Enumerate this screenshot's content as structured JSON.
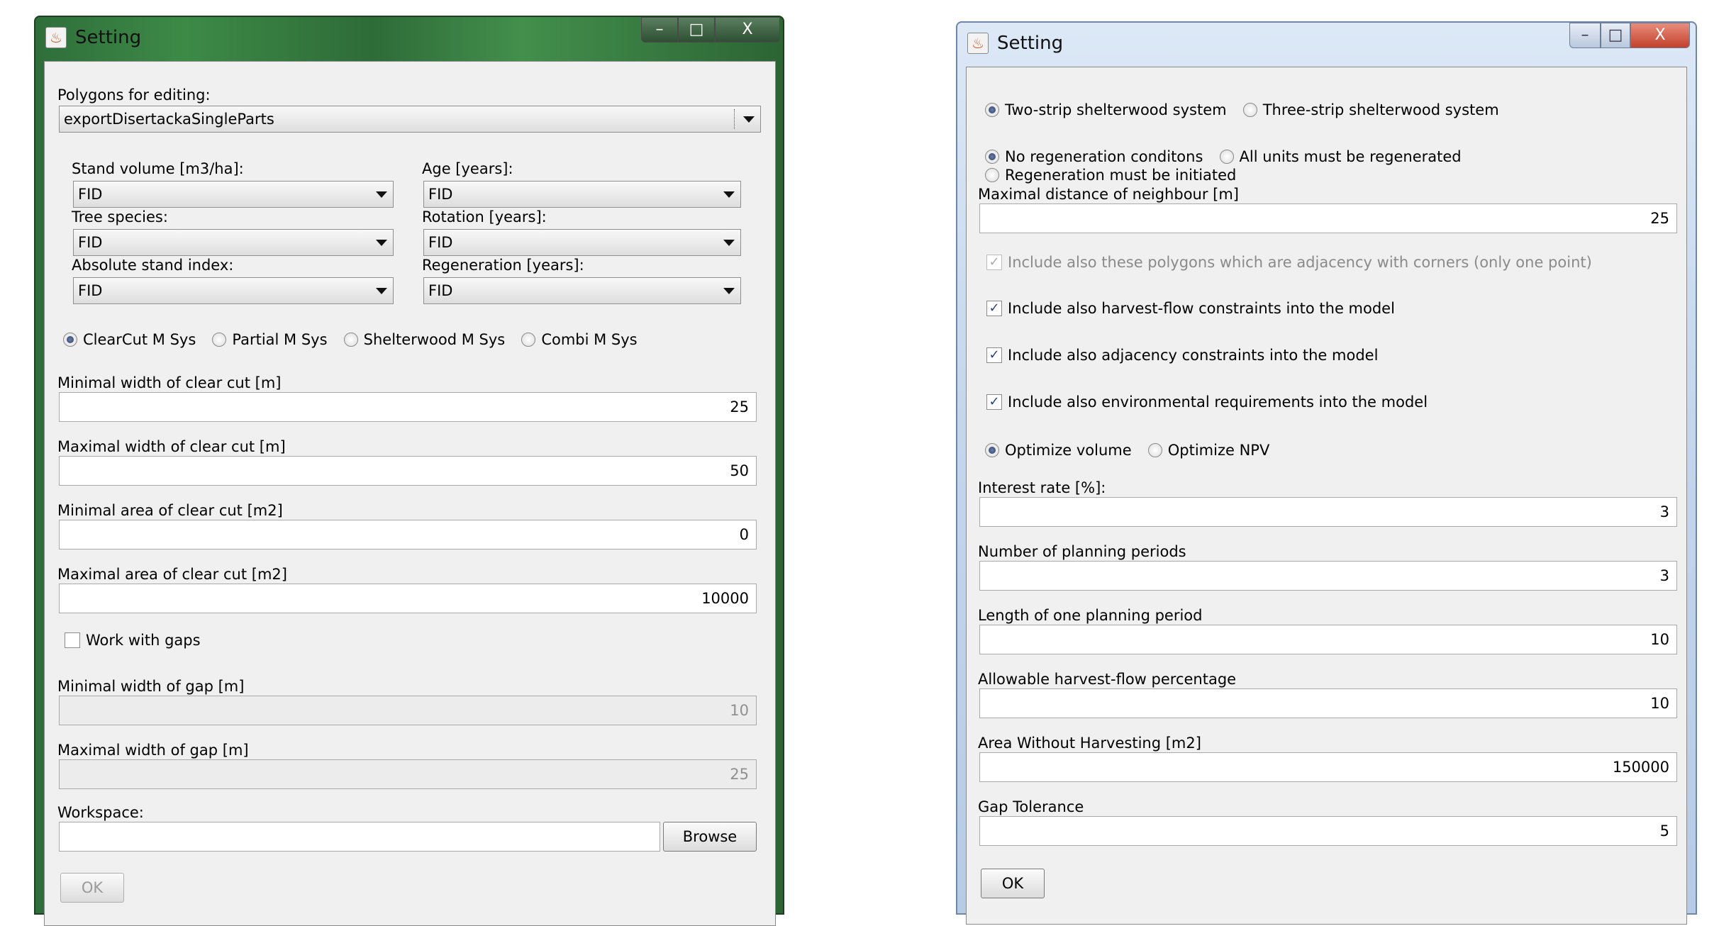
{
  "left_window": {
    "title": "Setting",
    "polygons_label": "Polygons for editing:",
    "polygons_value": "exportDisertackaSingleParts",
    "stand_volume_label": "Stand volume [m3/ha]:",
    "stand_volume_value": "FID",
    "age_label": "Age [years]:",
    "age_value": "FID",
    "tree_species_label": "Tree species:",
    "tree_species_value": "FID",
    "rotation_label": "Rotation [years]:",
    "rotation_value": "FID",
    "abs_index_label": "Absolute stand index:",
    "abs_index_value": "FID",
    "regeneration_label": "Regeneration [years]:",
    "regeneration_value": "FID",
    "systems": [
      "ClearCut M Sys",
      "Partial M Sys",
      "Shelterwood M Sys",
      "Combi M Sys"
    ],
    "min_width_label": "Minimal width of clear cut [m]",
    "min_width_value": "25",
    "max_width_label": "Maximal width of clear cut [m]",
    "max_width_value": "50",
    "min_area_label": "Minimal area of clear cut [m2]",
    "min_area_value": "0",
    "max_area_label": "Maximal area of clear cut [m2]",
    "max_area_value": "10000",
    "gaps_label": "Work with gaps",
    "min_gap_label": "Minimal width of gap [m]",
    "min_gap_value": "10",
    "max_gap_label": "Maximal width of gap [m]",
    "max_gap_value": "25",
    "workspace_label": "Workspace:",
    "workspace_value": "",
    "browse_label": "Browse",
    "ok_label": "OK"
  },
  "right_window": {
    "title": "Setting",
    "strip_options": [
      "Two-strip shelterwood system",
      "Three-strip shelterwood system"
    ],
    "regen_options": [
      "No regeneration conditons",
      "All units must be regenerated",
      "Regeneration must be initiated"
    ],
    "neighbour_label": "Maximal distance of neighbour [m]",
    "neighbour_value": "25",
    "cb_corners": "Include also these polygons which are adjacency with corners (only one point)",
    "cb_harvest": "Include also harvest-flow constraints into the model",
    "cb_adjacency": "Include also adjacency constraints into the model",
    "cb_environment": "Include also environmental requirements into the model",
    "optimize_options": [
      "Optimize volume",
      "Optimize NPV"
    ],
    "interest_label": "Interest rate [%]:",
    "interest_value": "3",
    "periods_label": "Number of planning periods",
    "periods_value": "3",
    "length_label": "Length of one planning period",
    "length_value": "10",
    "harvest_pct_label": "Allowable harvest-flow percentage",
    "harvest_pct_value": "10",
    "area_label": "Area Without Harvesting [m2]",
    "area_value": "150000",
    "gap_tol_label": "Gap Tolerance",
    "gap_tol_value": "5",
    "ok_label": "OK"
  },
  "window_controls": {
    "minimize": "–",
    "maximize": "□",
    "close": "X"
  }
}
